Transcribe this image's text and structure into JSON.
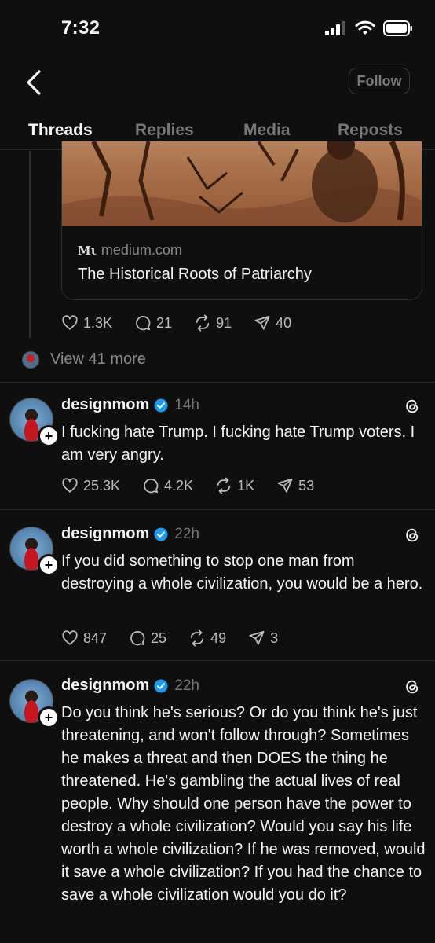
{
  "status_bar": {
    "time": "7:32"
  },
  "header": {
    "follow_label": "Follow"
  },
  "tabs": [
    {
      "label": "Threads",
      "active": true
    },
    {
      "label": "Replies"
    },
    {
      "label": "Media"
    },
    {
      "label": "Reposts"
    }
  ],
  "link_card": {
    "domain_mark": "Mι",
    "domain": "medium.com",
    "title": "The Historical Roots of Patriarchy"
  },
  "top_post_actions": {
    "likes": "1.3K",
    "replies": "21",
    "reposts": "91",
    "shares": "40"
  },
  "view_more": "View 41 more",
  "posts": [
    {
      "username": "designmom",
      "time": "14h",
      "text": "I fucking hate Trump. I fucking hate Trump voters. I am very angry.",
      "likes": "25.3K",
      "replies": "4.2K",
      "reposts": "1K",
      "shares": "53"
    },
    {
      "username": "designmom",
      "time": "22h",
      "text": "If you did something to stop one man from destroying a whole civilization, you would be a hero.",
      "likes": "847",
      "replies": "25",
      "reposts": "49",
      "shares": "3"
    },
    {
      "username": "designmom",
      "time": "22h",
      "text": "Do you think he's serious? Or do you think he's just threatening, and won't follow through? Sometimes he makes a threat and then DOES the thing he threatened. He's gambling the actual lives of real people. Why should one person have the power to destroy a whole civilization? Would you say his life worth a whole civilization? If he was removed, would it save a whole civilization? If you had the chance to save a whole civilization would you do it?"
    }
  ],
  "colors": {
    "background": "#0f0f0f",
    "text": "#f3f5f7",
    "muted": "#777777",
    "verified": "#1d9bf0"
  }
}
